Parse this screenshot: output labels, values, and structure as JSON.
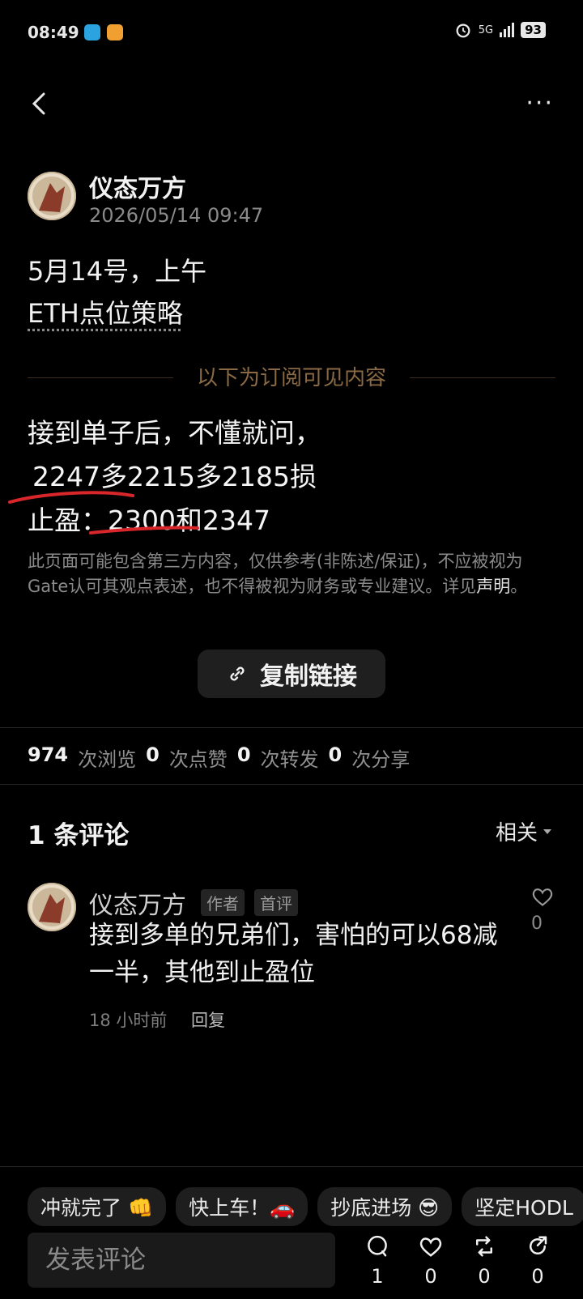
{
  "status": {
    "time": "08:49",
    "battery": "93",
    "network": "5G"
  },
  "author": {
    "name": "仪态万方",
    "date": "2026/05/14 09:47"
  },
  "post": {
    "line1": "5月14号，上午",
    "line2": "ETH点位策略",
    "subscriber_label": "以下为订阅可见内容",
    "content": [
      "接到单子后，不懂就问，",
      "2247多2215多2185损",
      "止盈：2300和2347"
    ],
    "disclaimer": "此页面可能包含第三方内容，仅供参考(非陈述/保证)，不应被视为Gate认可其观点表述，也不得被视为财务或专业建议。详见",
    "disclaimer_link": "声明",
    "disclaimer_end": "。",
    "copy_link": "复制链接"
  },
  "stats": {
    "views": "974",
    "views_label": "次浏览",
    "likes": "0",
    "likes_label": "次点赞",
    "reposts": "0",
    "reposts_label": "次转发",
    "shares": "0",
    "shares_label": "次分享"
  },
  "comments": {
    "title": "1 条评论",
    "sort": "相关",
    "items": [
      {
        "name": "仪态万方",
        "tag_author": "作者",
        "tag_first": "首评",
        "text": "接到多单的兄弟们，害怕的可以68减一半，其他到止盈位",
        "time": "18 小时前",
        "reply": "回复",
        "likes": "0"
      }
    ]
  },
  "quick_replies": [
    "冲就完了 👊",
    "快上车！🚗",
    "抄底进场 😎",
    "坚定HODL"
  ],
  "composer": {
    "placeholder": "发表评论"
  },
  "actions": {
    "comments": "1",
    "likes": "0",
    "reposts": "0",
    "shares": "0"
  }
}
